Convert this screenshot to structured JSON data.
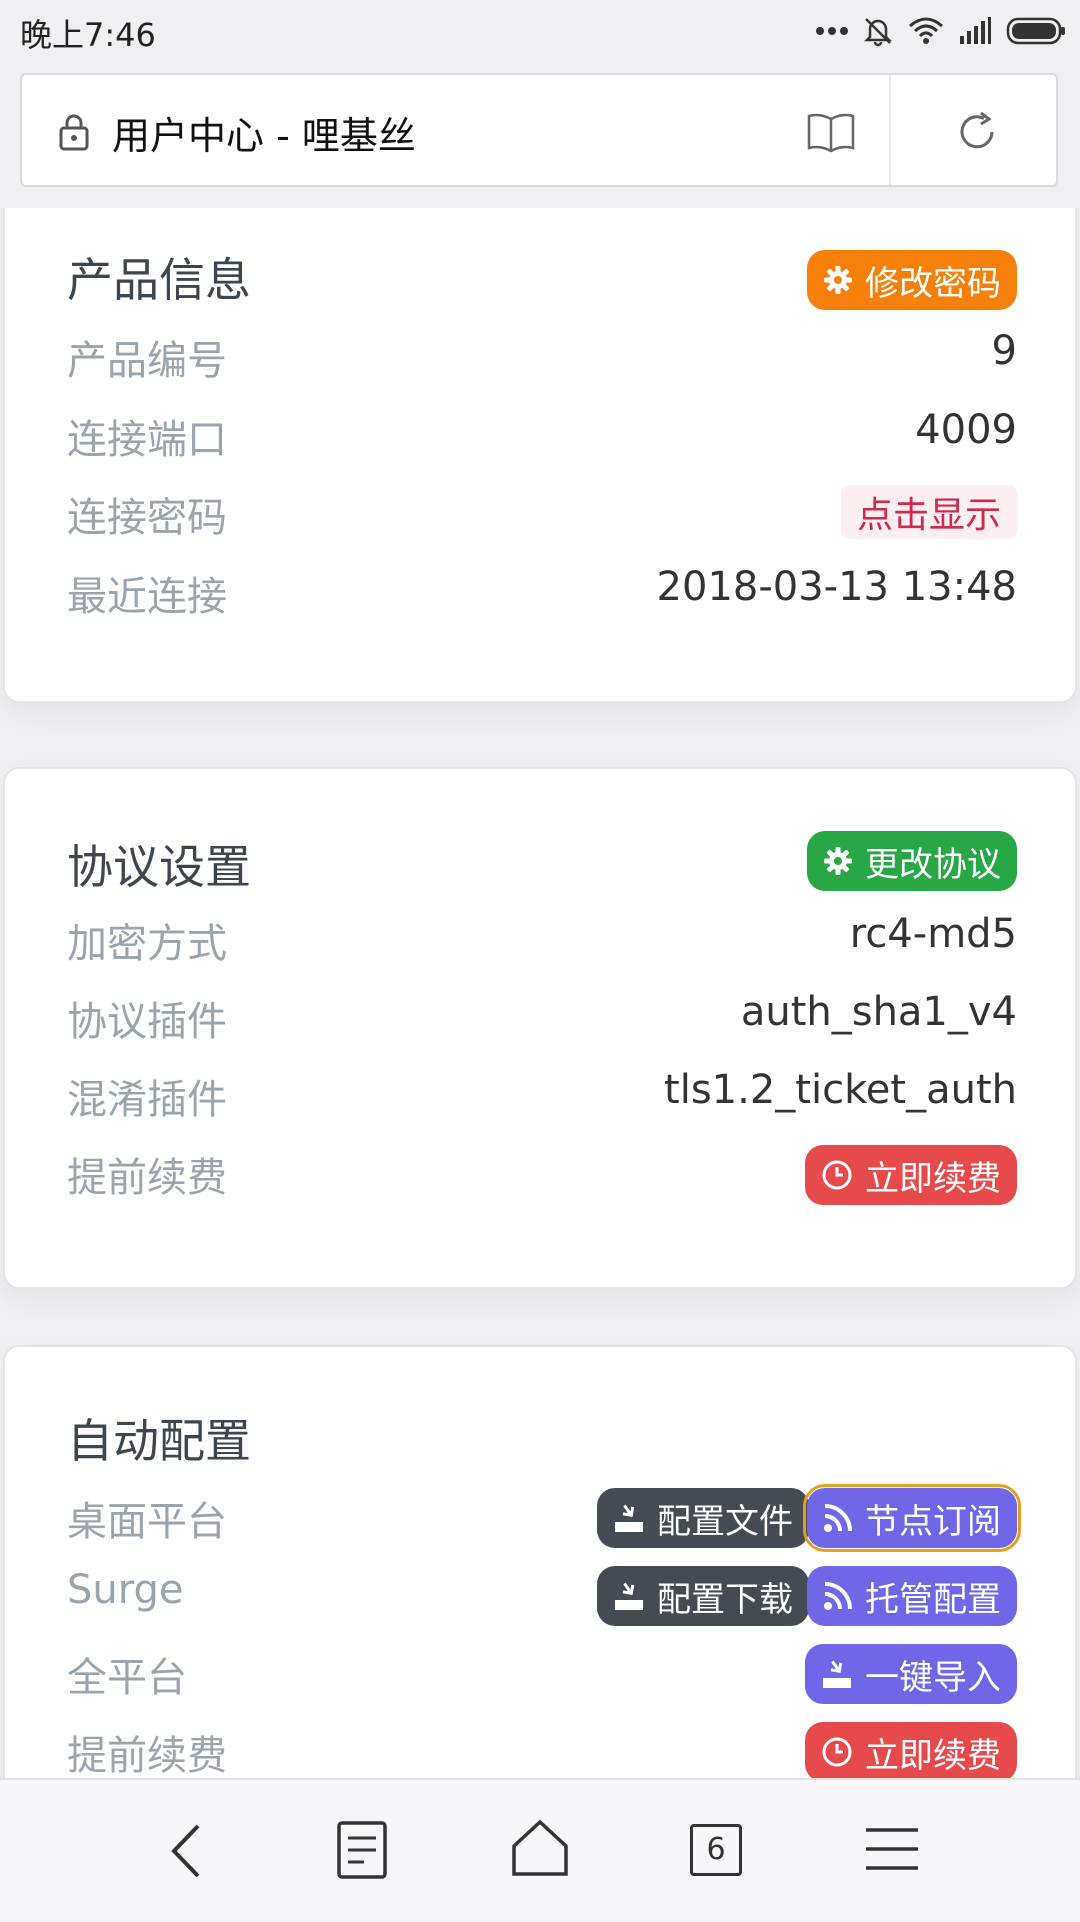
{
  "status_bar": {
    "time": "晚上7:46"
  },
  "browser": {
    "page_title": "用户中心 - 哩基丝",
    "tab_count": "6"
  },
  "product_info": {
    "title": "产品信息",
    "button_change_password": "修改密码",
    "rows": [
      {
        "label": "产品编号",
        "value": "9"
      },
      {
        "label": "连接端口",
        "value": "4009"
      },
      {
        "label": "连接密码",
        "value": "点击显示"
      },
      {
        "label": "最近连接",
        "value": "2018-03-13 13:48"
      }
    ]
  },
  "protocol_settings": {
    "title": "协议设置",
    "button_change_protocol": "更改协议",
    "rows": [
      {
        "label": "加密方式",
        "value": "rc4-md5"
      },
      {
        "label": "协议插件",
        "value": "auth_sha1_v4"
      },
      {
        "label": "混淆插件",
        "value": "tls1.2_ticket_auth"
      },
      {
        "label": "提前续费",
        "value": "立即续费"
      }
    ]
  },
  "auto_config": {
    "title": "自动配置",
    "rows": [
      {
        "label": "桌面平台",
        "buttons": [
          "配置文件",
          "节点订阅"
        ]
      },
      {
        "label": "Surge",
        "buttons": [
          "配置下载",
          "托管配置"
        ]
      },
      {
        "label": "全平台",
        "buttons": [
          "一键导入"
        ]
      },
      {
        "label": "提前续费",
        "buttons": [
          "立即续费"
        ]
      }
    ]
  },
  "colors": {
    "orange": "#f7800a",
    "green": "#27a745",
    "red": "#e64a4a",
    "dark": "#444b53",
    "purple": "#6f66e8",
    "label_gray": "#9aa4ae"
  }
}
